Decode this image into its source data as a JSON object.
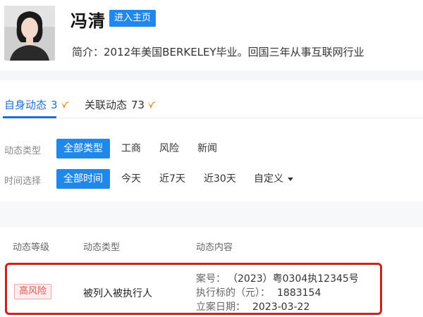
{
  "profile": {
    "name": "冯清",
    "homepage_button": "进入主页",
    "bio": "简介：2012年美国BERKELEY毕业。回国三年从事互联网行业"
  },
  "tabs": [
    {
      "label": "自身动态",
      "count": "3",
      "active": true
    },
    {
      "label": "关联动态",
      "count": "73",
      "active": false
    }
  ],
  "filters": {
    "type": {
      "label": "动态类型",
      "options": [
        "全部类型",
        "工商",
        "风险",
        "新闻"
      ],
      "selected": "全部类型"
    },
    "time": {
      "label": "时间选择",
      "options": [
        "全部时间",
        "今天",
        "近7天",
        "近30天",
        "自定义"
      ],
      "selected": "全部时间"
    }
  },
  "table": {
    "headers": [
      "动态等级",
      "动态类型",
      "动态内容"
    ],
    "rows": [
      {
        "level": "高风险",
        "type": "被列入被执行人",
        "details": [
          {
            "key": "案号：",
            "value": "（2023）粤0304执12345号"
          },
          {
            "key": "执行标的（元）：",
            "value": "1883154"
          },
          {
            "key": "立案日期：",
            "value": "2023-03-22"
          }
        ]
      }
    ]
  },
  "colors": {
    "accent": "#1f88ea",
    "active_tab": "#1f6fd6",
    "risk": "#e4534e",
    "highlight_border": "#d0201b"
  }
}
